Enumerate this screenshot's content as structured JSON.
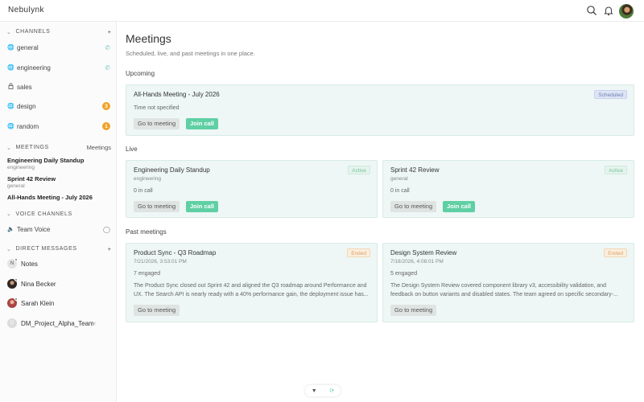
{
  "app": {
    "title": "Nebulynk"
  },
  "topbar": {
    "search_icon": "search-icon",
    "bell_icon": "bell-icon",
    "avatar": "user-avatar"
  },
  "sidebar": {
    "channels_header": "CHANNELS",
    "channels_add": "+",
    "channels": [
      {
        "name": "general",
        "icon": "globe-icon",
        "right": "phone-icon"
      },
      {
        "name": "engineering",
        "icon": "globe-icon",
        "right": "phone-icon"
      },
      {
        "name": "sales",
        "icon": "lock-icon",
        "right": ""
      },
      {
        "name": "design",
        "icon": "globe-icon",
        "badge": "3"
      },
      {
        "name": "random",
        "icon": "globe-icon",
        "badge": "1"
      }
    ],
    "meetings_header": "MEETINGS",
    "meetings_link": "Meetings",
    "meetings": [
      {
        "title": "Engineering Daily Standup",
        "sub": "engineering"
      },
      {
        "title": "Sprint 42 Review",
        "sub": "general"
      },
      {
        "title": "All-Hands Meeting - July 2026",
        "sub": ""
      }
    ],
    "voice_header": "VOICE CHANNELS",
    "voice": [
      {
        "name": "Team Voice"
      }
    ],
    "dm_header": "DIRECT MESSAGES",
    "dm_add": "+",
    "dms": [
      {
        "name": "Notes",
        "initial": "N"
      },
      {
        "name": "Nina Becker",
        "initial": ""
      },
      {
        "name": "Sarah Klein",
        "initial": ""
      },
      {
        "name": "DM_Project_Alpha_Team",
        "initial": "D"
      }
    ]
  },
  "main": {
    "title": "Meetings",
    "subtitle": "Scheduled, live, and past meetings in one place.",
    "upcoming_label": "Upcoming",
    "live_label": "Live",
    "past_label": "Past meetings",
    "go_label": "Go to meeting",
    "join_label": "Join call",
    "upcoming": [
      {
        "title": "All-Hands Meeting - July 2026",
        "meta": "Time not specified",
        "status": "Scheduled"
      }
    ],
    "live": [
      {
        "title": "Engineering Daily Standup",
        "sub": "engineering",
        "meta": "0 in call",
        "status": "Active"
      },
      {
        "title": "Sprint 42 Review",
        "sub": "general",
        "meta": "0 in call",
        "status": "Active"
      }
    ],
    "past": [
      {
        "title": "Product Sync - Q3 Roadmap",
        "sub": "7/21/2026, 3:53:01 PM",
        "meta": "7 engaged",
        "status": "Ended",
        "desc": "The Product Sync closed out Sprint 42 and aligned the Q3 roadmap around Performance and UX. The Search API is nearly ready with a 40% performance gain, the deployment issue has..."
      },
      {
        "title": "Design System Review",
        "sub": "7/18/2026, 4:08:01 PM",
        "meta": "5 engaged",
        "status": "Ended",
        "desc": "The Design System Review covered component library v3, accessibility validation, and feedback on button variants and disabled states. The team agreed on specific secondary-..."
      }
    ]
  },
  "colors": {
    "accent": "#5fcfa4",
    "badge": "#f0a32a",
    "card_bg": "#eef7f5"
  }
}
